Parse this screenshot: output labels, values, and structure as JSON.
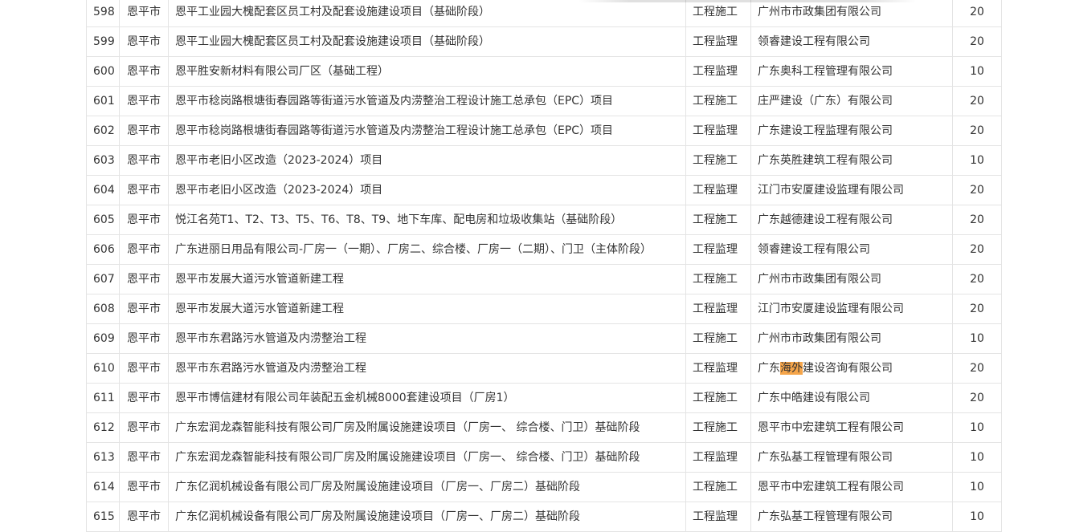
{
  "table": {
    "rows": [
      {
        "no": "598",
        "city": "恩平市",
        "project": "恩平工业园大槐配套区员工村及配套设施建设项目（基础阶段）",
        "type": "工程施工",
        "company": "广州市市政集团有限公司",
        "score": "20"
      },
      {
        "no": "599",
        "city": "恩平市",
        "project": "恩平工业园大槐配套区员工村及配套设施建设项目（基础阶段）",
        "type": "工程监理",
        "company": "领睿建设工程有限公司",
        "score": "20"
      },
      {
        "no": "600",
        "city": "恩平市",
        "project": "恩平胜安新材料有限公司厂区（基础工程）",
        "type": "工程监理",
        "company": "广东奥科工程管理有限公司",
        "score": "10"
      },
      {
        "no": "601",
        "city": "恩平市",
        "project": "恩平市稔岗路根塘街春园路等街道污水管道及内涝整治工程设计施工总承包（EPC）项目",
        "type": "工程施工",
        "company": "庄严建设（广东）有限公司",
        "score": "20"
      },
      {
        "no": "602",
        "city": "恩平市",
        "project": "恩平市稔岗路根塘街春园路等街道污水管道及内涝整治工程设计施工总承包（EPC）项目",
        "type": "工程监理",
        "company": "广东建设工程监理有限公司",
        "score": "20"
      },
      {
        "no": "603",
        "city": "恩平市",
        "project": "恩平市老旧小区改造（2023-2024）项目",
        "type": "工程施工",
        "company": "广东英胜建筑工程有限公司",
        "score": "10"
      },
      {
        "no": "604",
        "city": "恩平市",
        "project": "恩平市老旧小区改造（2023-2024）项目",
        "type": "工程监理",
        "company": "江门市安厦建设监理有限公司",
        "score": "20"
      },
      {
        "no": "605",
        "city": "恩平市",
        "project": "悦江名苑T1、T2、T3、T5、T6、T8、T9、地下车库、配电房和垃圾收集站（基础阶段）",
        "type": "工程施工",
        "company": "广东越德建设工程有限公司",
        "score": "20"
      },
      {
        "no": "606",
        "city": "恩平市",
        "project": "广东进丽日用品有限公司-厂房一（一期）、厂房二、综合楼、厂房一（二期）、门卫（主体阶段）",
        "type": "工程监理",
        "company": "领睿建设工程有限公司",
        "score": "20"
      },
      {
        "no": "607",
        "city": "恩平市",
        "project": "恩平市发展大道污水管道新建工程",
        "type": "工程施工",
        "company": "广州市市政集团有限公司",
        "score": "20"
      },
      {
        "no": "608",
        "city": "恩平市",
        "project": "恩平市发展大道污水管道新建工程",
        "type": "工程监理",
        "company": "江门市安厦建设监理有限公司",
        "score": "20"
      },
      {
        "no": "609",
        "city": "恩平市",
        "project": "恩平市东君路污水管道及内涝整治工程",
        "type": "工程施工",
        "company": "广州市市政集团有限公司",
        "score": "10"
      },
      {
        "no": "610",
        "city": "恩平市",
        "project": "恩平市东君路污水管道及内涝整治工程",
        "type": "工程监理",
        "company_pre": "广东",
        "company_hl": "海外",
        "company_post": "建设咨询有限公司",
        "score": "20"
      },
      {
        "no": "611",
        "city": "恩平市",
        "project": "恩平市博信建材有限公司年装配五金机械8000套建设项目（厂房1）",
        "type": "工程施工",
        "company": "广东中皓建设有限公司",
        "score": "20"
      },
      {
        "no": "612",
        "city": "恩平市",
        "project": "广东宏润龙森智能科技有限公司厂房及附属设施建设项目（厂房一、 综合楼、门卫）基础阶段",
        "type": "工程施工",
        "company": "恩平市中宏建筑工程有限公司",
        "score": "10"
      },
      {
        "no": "613",
        "city": "恩平市",
        "project": "广东宏润龙森智能科技有限公司厂房及附属设施建设项目（厂房一、 综合楼、门卫）基础阶段",
        "type": "工程监理",
        "company": "广东弘基工程管理有限公司",
        "score": "10"
      },
      {
        "no": "614",
        "city": "恩平市",
        "project": "广东亿润机械设备有限公司厂房及附属设施建设项目（厂房一、厂房二）基础阶段",
        "type": "工程施工",
        "company": "恩平市中宏建筑工程有限公司",
        "score": "10"
      },
      {
        "no": "615",
        "city": "恩平市",
        "project": "广东亿润机械设备有限公司厂房及附属设施建设项目（厂房一、厂房二）基础阶段",
        "type": "工程监理",
        "company": "广东弘基工程管理有限公司",
        "score": "10"
      }
    ]
  },
  "colors": {
    "border": "#e4e4e4",
    "text": "#333333",
    "highlight": "#f5a54a"
  }
}
